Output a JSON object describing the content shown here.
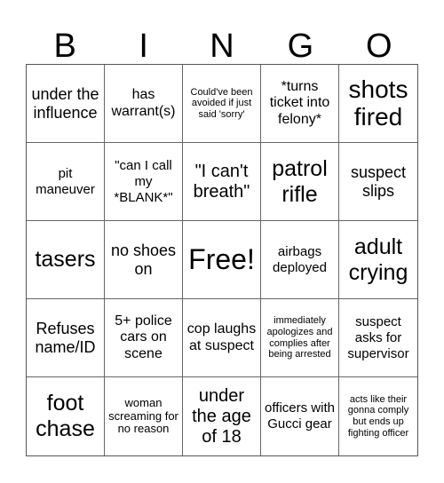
{
  "header": {
    "letters": [
      "B",
      "I",
      "N",
      "G",
      "O"
    ]
  },
  "cells": [
    "under the influence",
    "has warrant(s)",
    "Could've been avoided if just said 'sorry'",
    "*turns ticket into felony*",
    "shots fired",
    "pit maneuver",
    "\"can I call my *BLANK*\"",
    "\"I can't breath\"",
    "patrol rifle",
    "suspect slips",
    "tasers",
    "no shoes on",
    "Free!",
    "airbags deployed",
    "adult crying",
    "Refuses name/ID",
    "5+ police cars on scene",
    "cop laughs at suspect",
    "immediately apologizes and complies after being arrested",
    "suspect asks for supervisor",
    "foot chase",
    "woman screaming for no reason",
    "under the age of 18",
    "officers with Gucci gear",
    "acts like their gonna comply but ends up fighting officer"
  ]
}
